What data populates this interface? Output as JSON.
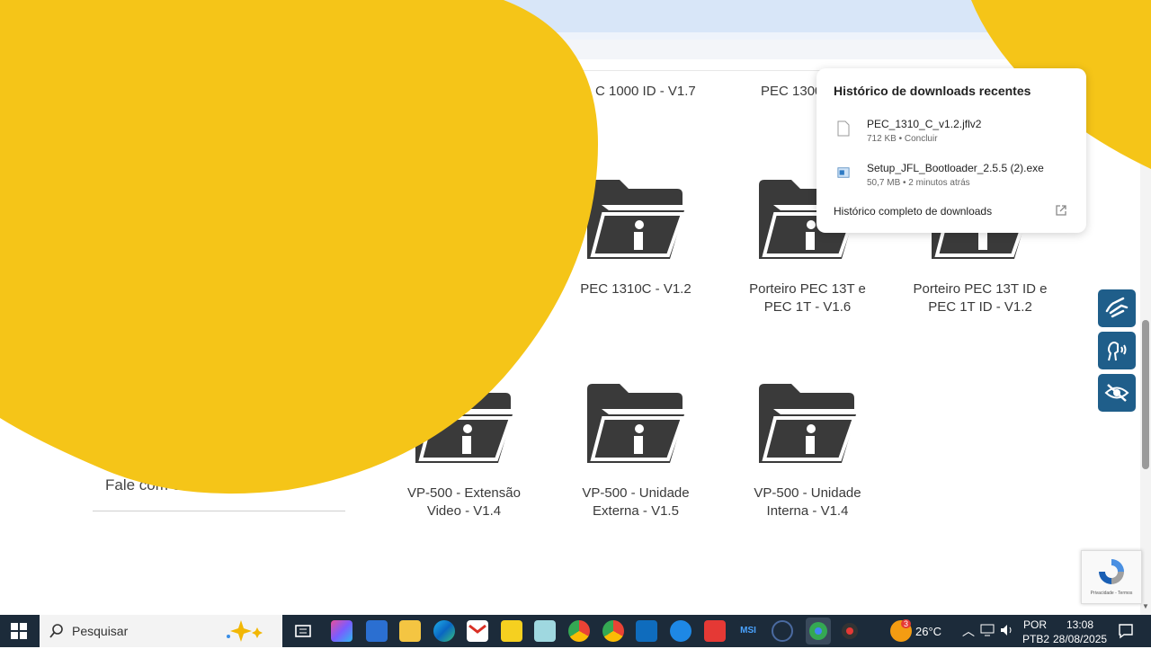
{
  "grid": {
    "top_partial_labels": [
      "C 1000 ID - V1.7",
      "PEC 1300"
    ],
    "folders": [
      {
        "line1": "PEC 1310C - V1.2",
        "line2": ""
      },
      {
        "line1": "Porteiro PEC 13T e",
        "line2": "PEC 1T - V1.6"
      },
      {
        "line1": "Porteiro PEC 13T ID e",
        "line2": "PEC 1T ID - V1.2"
      },
      {
        "line1": "VP-500 - Extensão",
        "line2": "Video - V1.4"
      },
      {
        "line1": "VP-500 - Unidade",
        "line2": "Externa - V1.5"
      },
      {
        "line1": "VP-500 - Unidade",
        "line2": "Interna - V1.4"
      }
    ]
  },
  "sidebar": {
    "link_partial": "Fale com o"
  },
  "downloads": {
    "title": "Histórico de downloads recentes",
    "items": [
      {
        "name": "PEC_1310_C_v1.2.jflv2",
        "meta": "712 KB • Concluir",
        "icon": "file-icon"
      },
      {
        "name": "Setup_JFL_Bootloader_2.5.5 (2).exe",
        "meta": "50,7 MB • 2 minutos atrás",
        "icon": "installer-icon"
      }
    ],
    "footer": "Histórico completo de downloads"
  },
  "accessibility": [
    "sign-language-icon",
    "voice-reader-icon",
    "hide-eye-icon"
  ],
  "recaptcha": {
    "text": "Privacidade - Termos"
  },
  "taskbar": {
    "search_placeholder": "Pesquisar",
    "weather_temp": "26°C",
    "weather_badge": "3",
    "lang1": "POR",
    "lang2": "PTB2",
    "time": "13:08",
    "date": "28/08/2025"
  },
  "colors": {
    "accent_yellow": "#f5c518",
    "folder": "#3a3a3a",
    "access_blue": "#1f5e8a",
    "taskbar": "#1c2b3a"
  }
}
